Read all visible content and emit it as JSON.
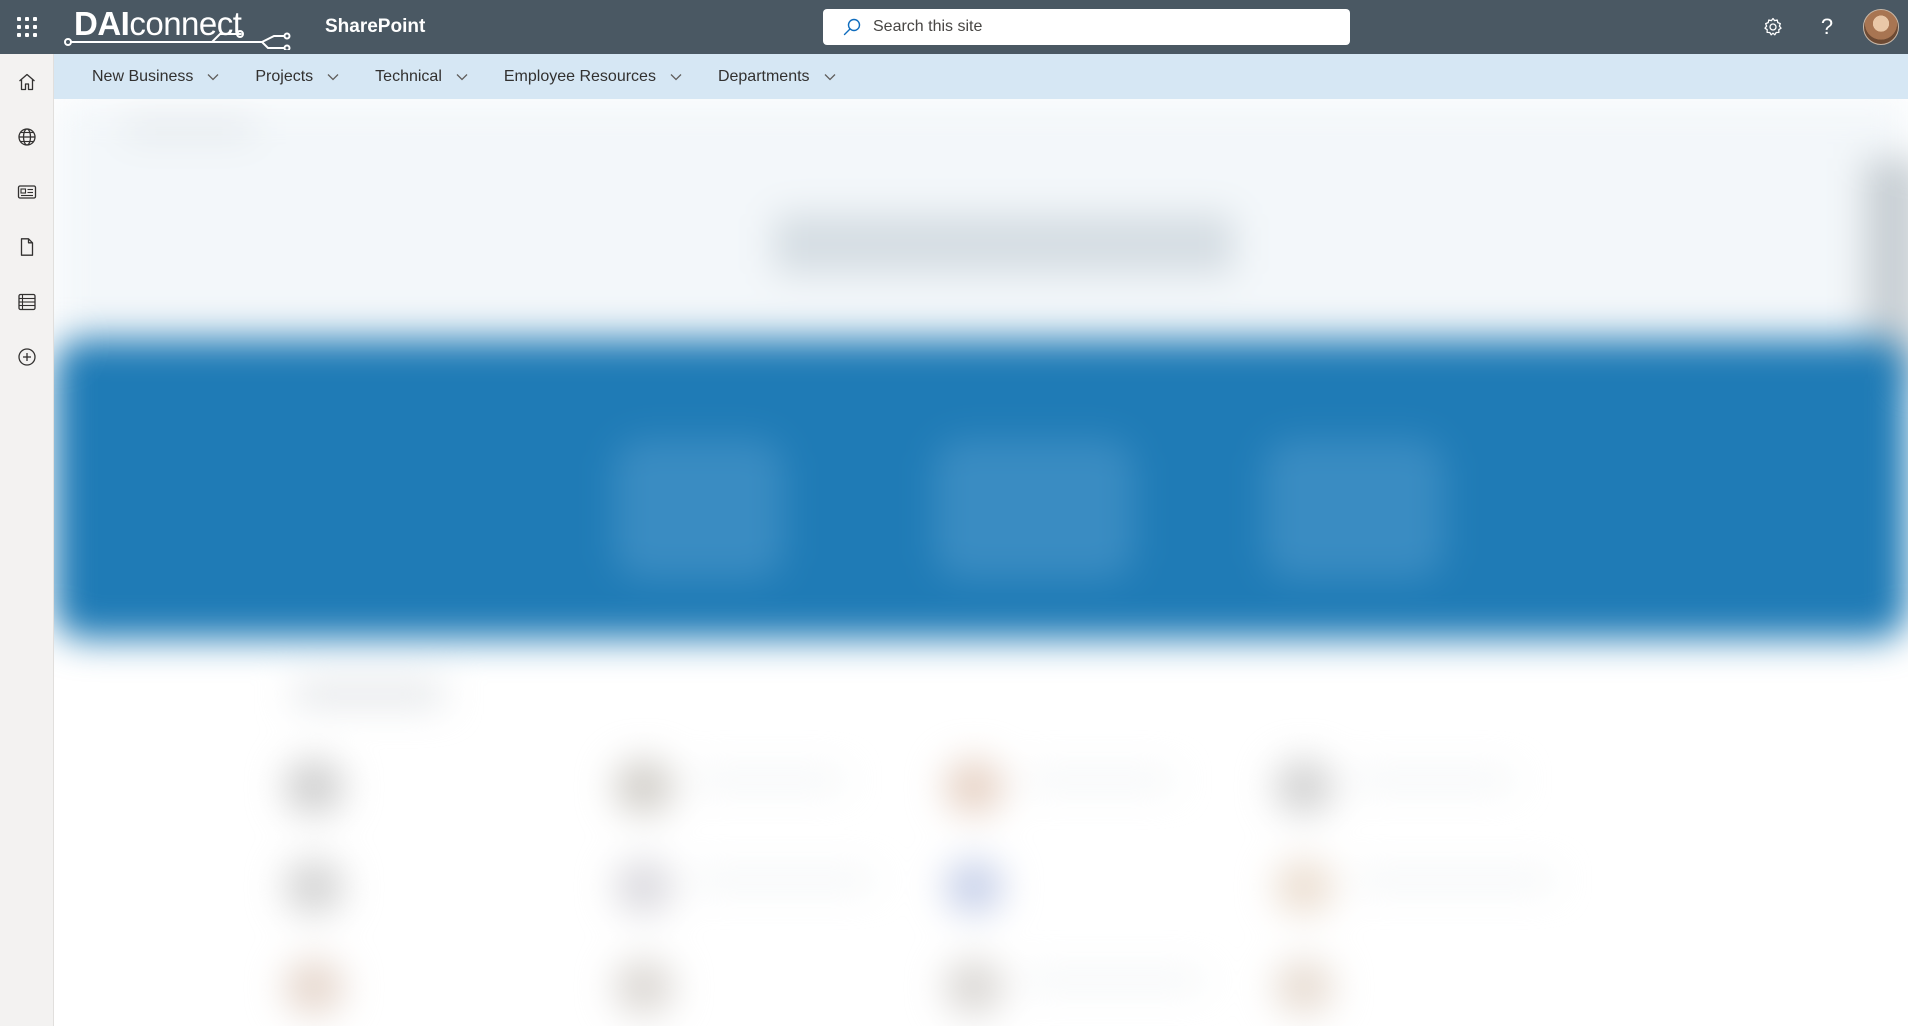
{
  "suite_bar": {
    "brand": {
      "prefix": "DAI",
      "suffix": "connect"
    },
    "app_name": "SharePoint",
    "search": {
      "placeholder": "Search this site",
      "value": ""
    },
    "icons": [
      "waffle-icon",
      "settings-icon",
      "help-icon",
      "avatar"
    ]
  },
  "app_bar": {
    "items": [
      {
        "icon": "home-icon"
      },
      {
        "icon": "globe-icon"
      },
      {
        "icon": "news-icon"
      },
      {
        "icon": "document-icon"
      },
      {
        "icon": "list-icon"
      },
      {
        "icon": "add-circle-icon"
      }
    ]
  },
  "hub_nav": {
    "items": [
      {
        "label": "New Business"
      },
      {
        "label": "Projects"
      },
      {
        "label": "Technical"
      },
      {
        "label": "Employee Resources"
      },
      {
        "label": "Departments"
      }
    ]
  },
  "colors": {
    "suite_bar_bg": "#4a5863",
    "hub_nav_bg": "#d6e7f4",
    "app_bar_bg": "#f3f2f1",
    "accent_band": "#1f7bb6"
  }
}
